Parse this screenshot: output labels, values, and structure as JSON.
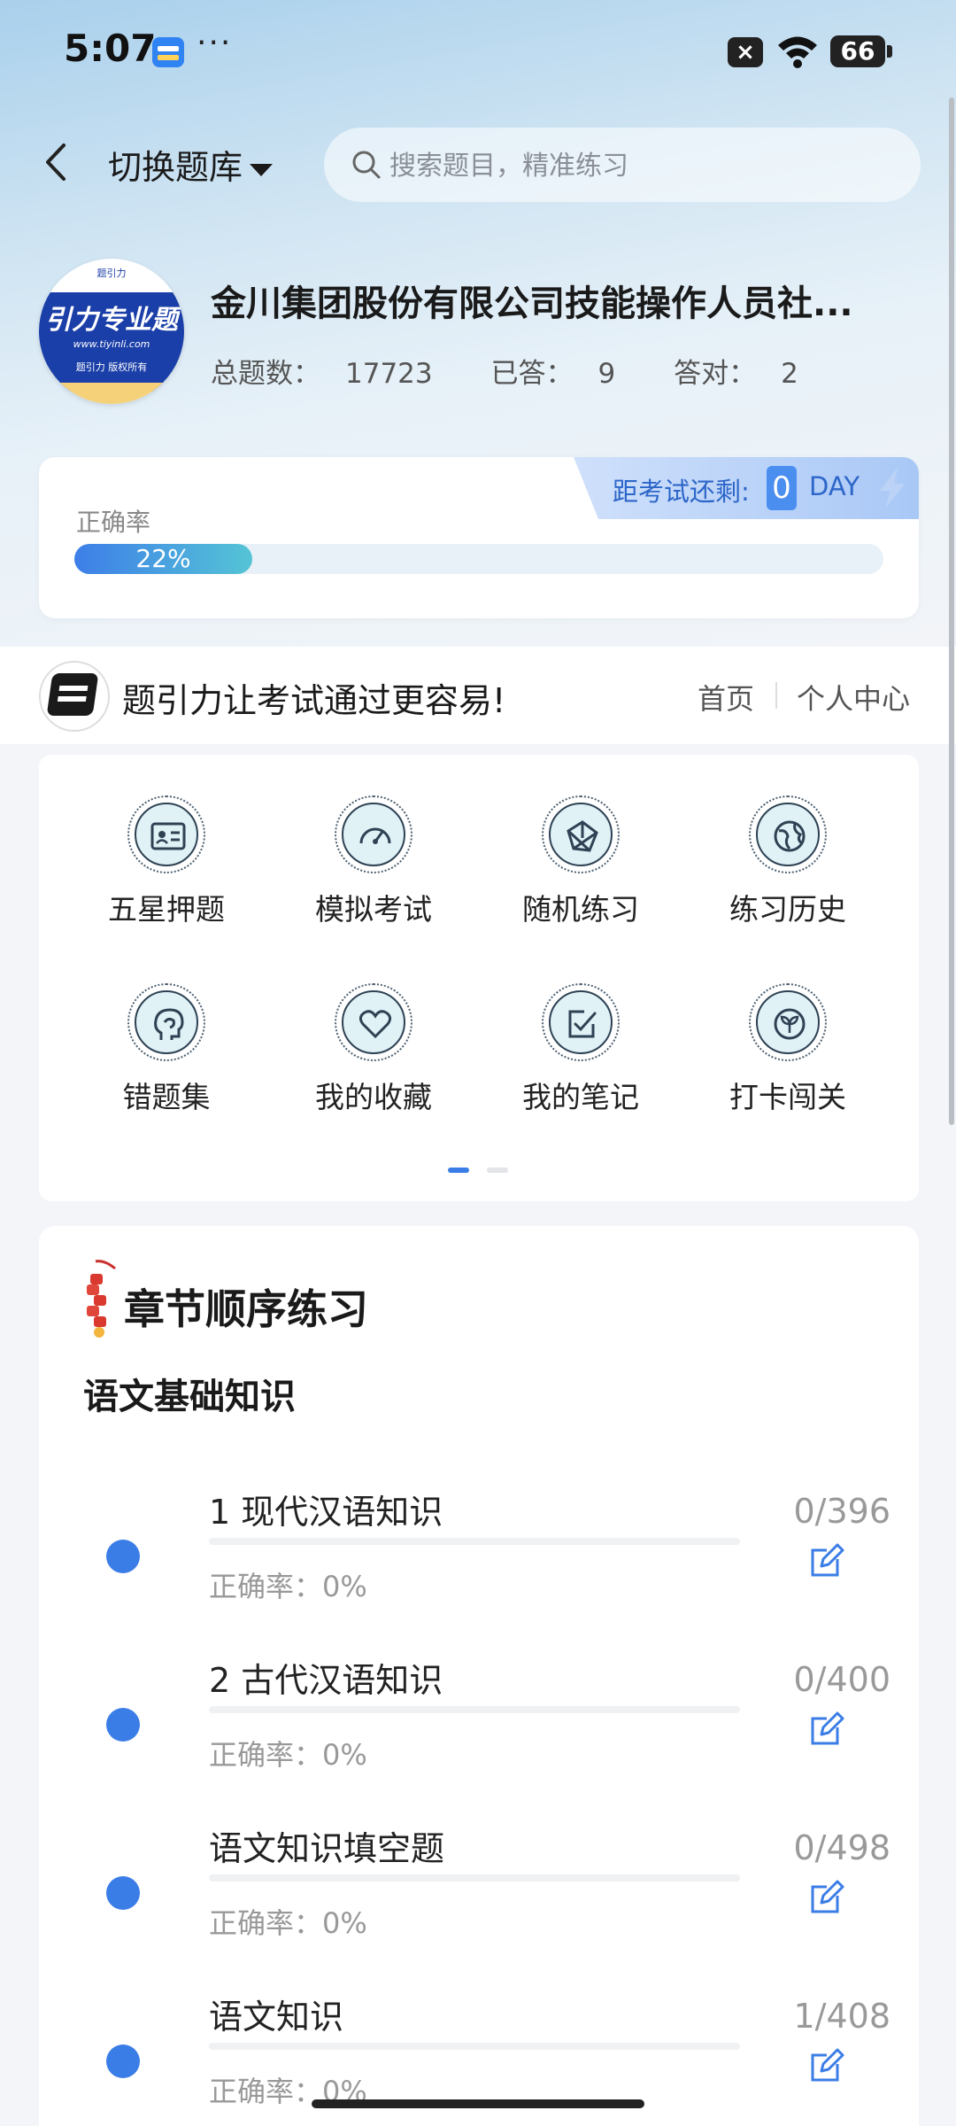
{
  "status_bar": {
    "time": "5:07",
    "more": "···",
    "sim": "×",
    "battery": "66"
  },
  "nav": {
    "switch_label": "切换题库",
    "search_placeholder": "搜索题目，精准练习"
  },
  "bank": {
    "logo_text": "引力专业题",
    "logo_url": "www.tiyinli.com",
    "logo_sub": "题引力 版权所有",
    "title": "金川集团股份有限公司技能操作人员社...",
    "stats": [
      {
        "label": "总题数：",
        "value": "17723"
      },
      {
        "label": "已答：",
        "value": "9"
      },
      {
        "label": "答对：",
        "value": "2"
      }
    ]
  },
  "accuracy_card": {
    "label": "正确率",
    "percent_text": "22%",
    "percent": 22,
    "countdown_label": "距考试还剩:",
    "countdown_value": "0",
    "countdown_unit": "DAY"
  },
  "banner": {
    "slogan": "题引力让考试通过更容易!",
    "home": "首页",
    "profile": "个人中心"
  },
  "functions": [
    {
      "label": "五星押题",
      "icon": "id-card-icon"
    },
    {
      "label": "模拟考试",
      "icon": "gauge-icon"
    },
    {
      "label": "随机练习",
      "icon": "network-icon"
    },
    {
      "label": "练习历史",
      "icon": "globe-icon"
    },
    {
      "label": "错题集",
      "icon": "brain-icon"
    },
    {
      "label": "我的收藏",
      "icon": "heart-icon"
    },
    {
      "label": "我的笔记",
      "icon": "note-check-icon"
    },
    {
      "label": "打卡闯关",
      "icon": "leaf-icon"
    }
  ],
  "chapter": {
    "heading": "章节顺序练习",
    "section": "语文基础知识",
    "items": [
      {
        "title": "1 现代汉语知识",
        "rate": "正确率：0%",
        "count": "0/396"
      },
      {
        "title": "2 古代汉语知识",
        "rate": "正确率：0%",
        "count": "0/400"
      },
      {
        "title": "语文知识填空题",
        "rate": "正确率：0%",
        "count": "0/498"
      },
      {
        "title": "语文知识",
        "rate": "正确率：0%",
        "count": "1/408"
      }
    ]
  },
  "colors": {
    "accent": "#3b7de6",
    "teal": "#55c4d6",
    "countdown_text": "#2d66c9"
  }
}
